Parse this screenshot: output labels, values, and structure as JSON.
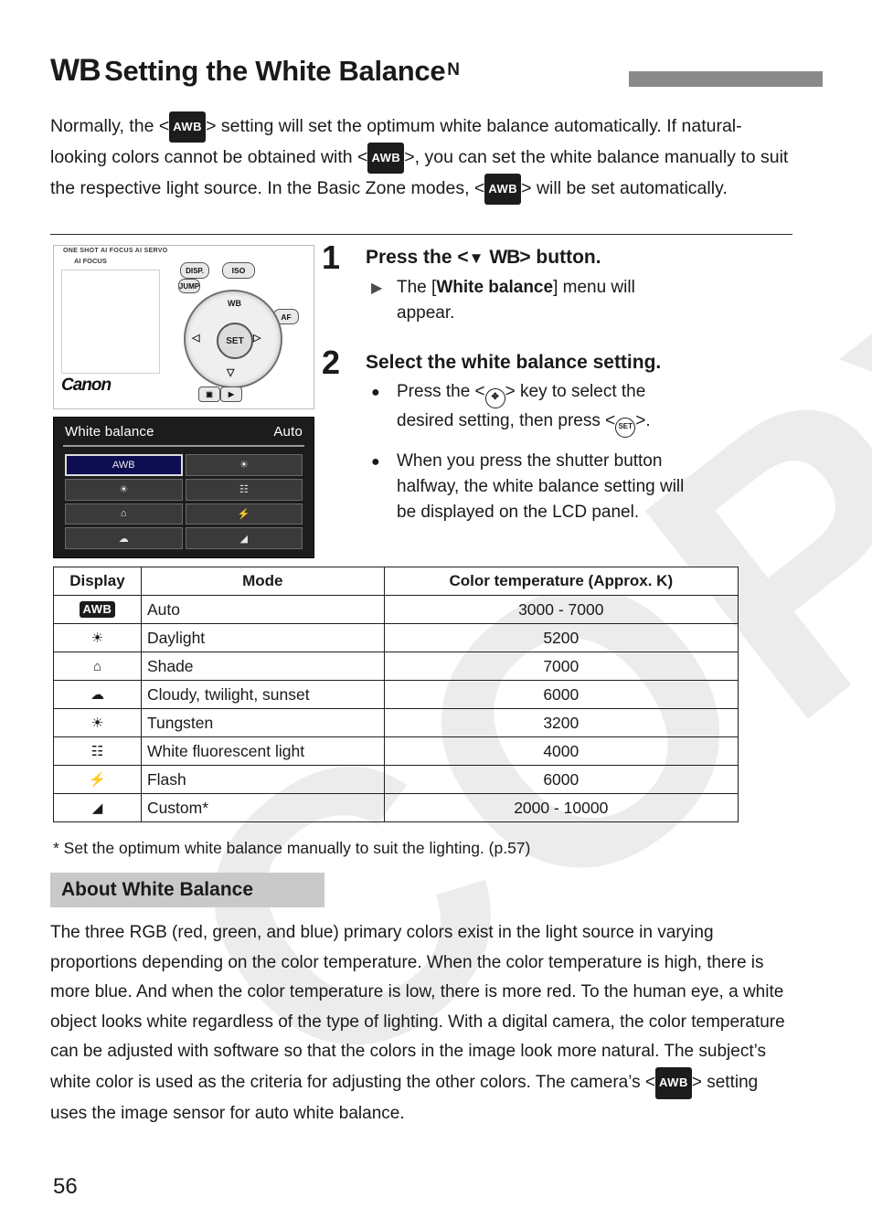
{
  "title": {
    "wb_symbol": "WB",
    "text": "Setting the White Balance",
    "star": "N"
  },
  "intro": {
    "line1_a": "Normally, the <",
    "awb": "AWB",
    "line1_b": "> setting will set the optimum white balance",
    "line2_a": "automatically. If natural-looking colors cannot be obtained with <",
    "line2_b": ">,",
    "line3": "you can set the white balance manually to suit the respective light",
    "line4_a": "source. In the Basic Zone modes, <",
    "line4_b": "> will be set automatically."
  },
  "camera_figure": {
    "top_label": "ONE SHOT  AI FOCUS  AI SERVO",
    "top_label2": "AI FOCUS",
    "brand": "Canon",
    "iso_button": "ISO",
    "disp_button": "DISP.",
    "af_button": "AF",
    "jump_button": "JUMP",
    "set_button": "SET",
    "dial_up": "WB",
    "dial_down": "",
    "dial_left": "",
    "dial_right": ""
  },
  "wb_menu": {
    "title": "White balance",
    "value": "Auto",
    "cells": [
      {
        "label": "AWB",
        "selected": true
      },
      {
        "label": "☀",
        "selected": false
      },
      {
        "label": "☀",
        "selected": false
      },
      {
        "label": "☷",
        "selected": false
      },
      {
        "label": "⌂",
        "selected": false
      },
      {
        "label": "⚡",
        "selected": false
      },
      {
        "label": "☁",
        "selected": false
      },
      {
        "label": "◢",
        "selected": false
      }
    ]
  },
  "steps": [
    {
      "num": "1",
      "heading_a": "Press the <",
      "heading_wb": "WB",
      "heading_b": "> button.",
      "bullets": [
        {
          "marker": "triangle",
          "text_a": "The [",
          "bold": "White balance",
          "text_b": "] menu will",
          "text_c": "appear."
        }
      ]
    },
    {
      "num": "2",
      "heading": "Select the white balance setting.",
      "bullets": [
        {
          "marker": "dot",
          "text_a": "Press the <",
          "key": "✥",
          "text_b": "> key to select the",
          "text_c": "desired setting, then press <",
          "key2": "SET",
          "text_d": ">."
        },
        {
          "marker": "dot",
          "text_a": "When you press the shutter button",
          "text_b": "halfway, the white balance setting will",
          "text_c": "be displayed on the LCD panel."
        }
      ]
    }
  ],
  "table": {
    "headers": [
      "Display",
      "Mode",
      "Color temperature (Approx. K)"
    ],
    "rows": [
      {
        "icon": "AWB",
        "icon_type": "badge",
        "mode": "Auto",
        "temp": "3000 - 7000"
      },
      {
        "icon": "☀",
        "icon_type": "glyph",
        "mode": "Daylight",
        "temp": "5200"
      },
      {
        "icon": "⌂",
        "icon_type": "glyph",
        "mode": "Shade",
        "temp": "7000"
      },
      {
        "icon": "☁",
        "icon_type": "glyph",
        "mode": "Cloudy, twilight, sunset",
        "temp": "6000"
      },
      {
        "icon": "☀",
        "icon_type": "glyph",
        "mode": "Tungsten",
        "temp": "3200"
      },
      {
        "icon": "☷",
        "icon_type": "glyph",
        "mode": "White fluorescent light",
        "temp": "4000"
      },
      {
        "icon": "⚡",
        "icon_type": "glyph",
        "mode": "Flash",
        "temp": "6000"
      },
      {
        "icon": "◢",
        "icon_type": "glyph",
        "mode": "Custom*",
        "temp": "2000 - 10000"
      }
    ]
  },
  "footnote": "* Set the optimum white balance manually to suit the lighting. (p.57)",
  "about": {
    "heading": "About White Balance",
    "line1": "The three RGB (red, green, and blue) primary colors exist in the light source in",
    "line2": "varying proportions depending on the color temperature. When the color",
    "line3": "temperature is high, there is more blue. And when the color temperature is low,",
    "line4": "there is more red. To the human eye, a white object looks white regardless of",
    "line5": "the type of lighting. With a digital camera, the color temperature can be",
    "line6": "adjusted with software so that the colors in the image look more natural. The",
    "line7": "subject’s white color is used as the criteria for adjusting the other colors. The",
    "line8_a": "camera’s <",
    "line8_awb": "AWB",
    "line8_b": "> setting uses the image sensor for auto white balance."
  },
  "page_number": "56",
  "watermark": "COPY"
}
